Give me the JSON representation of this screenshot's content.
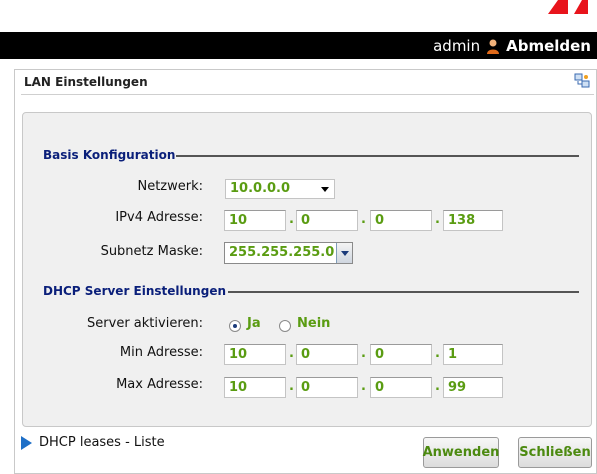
{
  "header": {
    "username": "admin",
    "logout_label": "Abmelden"
  },
  "panel": {
    "title": "LAN Einstellungen"
  },
  "basis": {
    "legend": "Basis Konfiguration",
    "network_label": "Netzwerk:",
    "network_value": "10.0.0.0",
    "ipv4_label": "IPv4 Adresse:",
    "ipv4": [
      "10",
      "0",
      "0",
      "138"
    ],
    "subnet_label": "Subnetz Maske:",
    "subnet_value": "255.255.255.0"
  },
  "dhcp": {
    "legend": "DHCP Server Einstellungen",
    "server_label": "Server aktivieren:",
    "yes_label": "Ja",
    "no_label": "Nein",
    "selected": "Ja",
    "min_label": "Min Adresse:",
    "min": [
      "10",
      "0",
      "0",
      "1"
    ],
    "max_label": "Max Adresse:",
    "max": [
      "10",
      "0",
      "0",
      "99"
    ]
  },
  "footer": {
    "leases_label": "DHCP leases - Liste",
    "apply_label": "Anwenden",
    "close_label": "Schließen"
  },
  "colors": {
    "accent_green": "#5a9c12",
    "legend_blue": "#0a1f7a",
    "header_bg": "#000000",
    "logo_red": "#e8141c"
  }
}
